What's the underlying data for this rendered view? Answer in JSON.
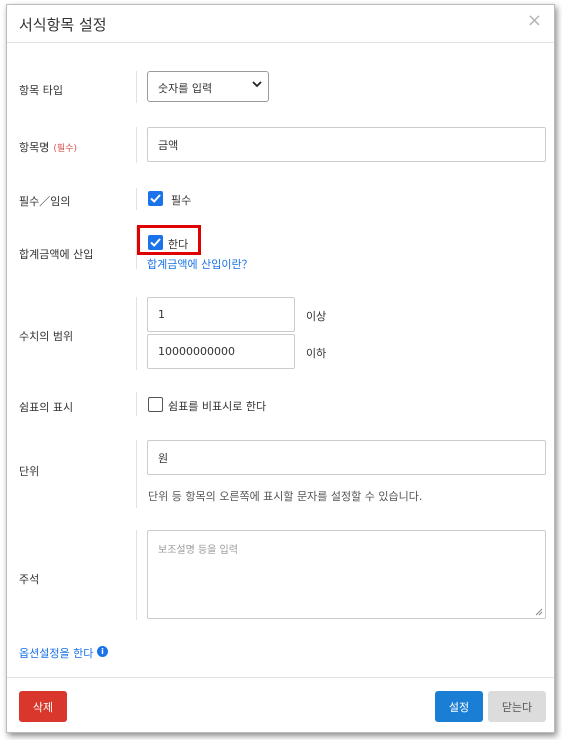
{
  "dialog": {
    "title": "서식항목 설정",
    "close_glyph": "×"
  },
  "fields": {
    "type": {
      "label": "항목 타입",
      "selected": "숫자를 입력"
    },
    "name": {
      "label": "항목명",
      "required_mark": "(필수)",
      "value": "금액"
    },
    "required": {
      "label": "필수／임의",
      "checkbox_label": "필수",
      "checked": true
    },
    "total": {
      "label": "합계금액에 산입",
      "checkbox_label": "한다",
      "checked": true,
      "help_link": "합계금액에 산입이란？"
    },
    "range": {
      "label": "수치의 범위",
      "min_value": "1",
      "min_suffix": "이상",
      "max_value": "10000000000",
      "max_suffix": "이하"
    },
    "comma": {
      "label": "쉼표의 표시",
      "checkbox_label": "쉼표를 비표시로 한다",
      "checked": false
    },
    "unit": {
      "label": "단위",
      "value": "원",
      "hint": "단위 등 항목의 오른쪽에 표시할 문자를 설정할 수 있습니다."
    },
    "note": {
      "label": "주석",
      "placeholder": "보조설명 등을 입력"
    }
  },
  "options_link": "옵션설정을 한다",
  "footer": {
    "delete_label": "삭제",
    "set_label": "설정",
    "close_label": "닫는다"
  },
  "colors": {
    "primary": "#1a73e8",
    "danger": "#d9372b",
    "highlight": "#e00000"
  }
}
